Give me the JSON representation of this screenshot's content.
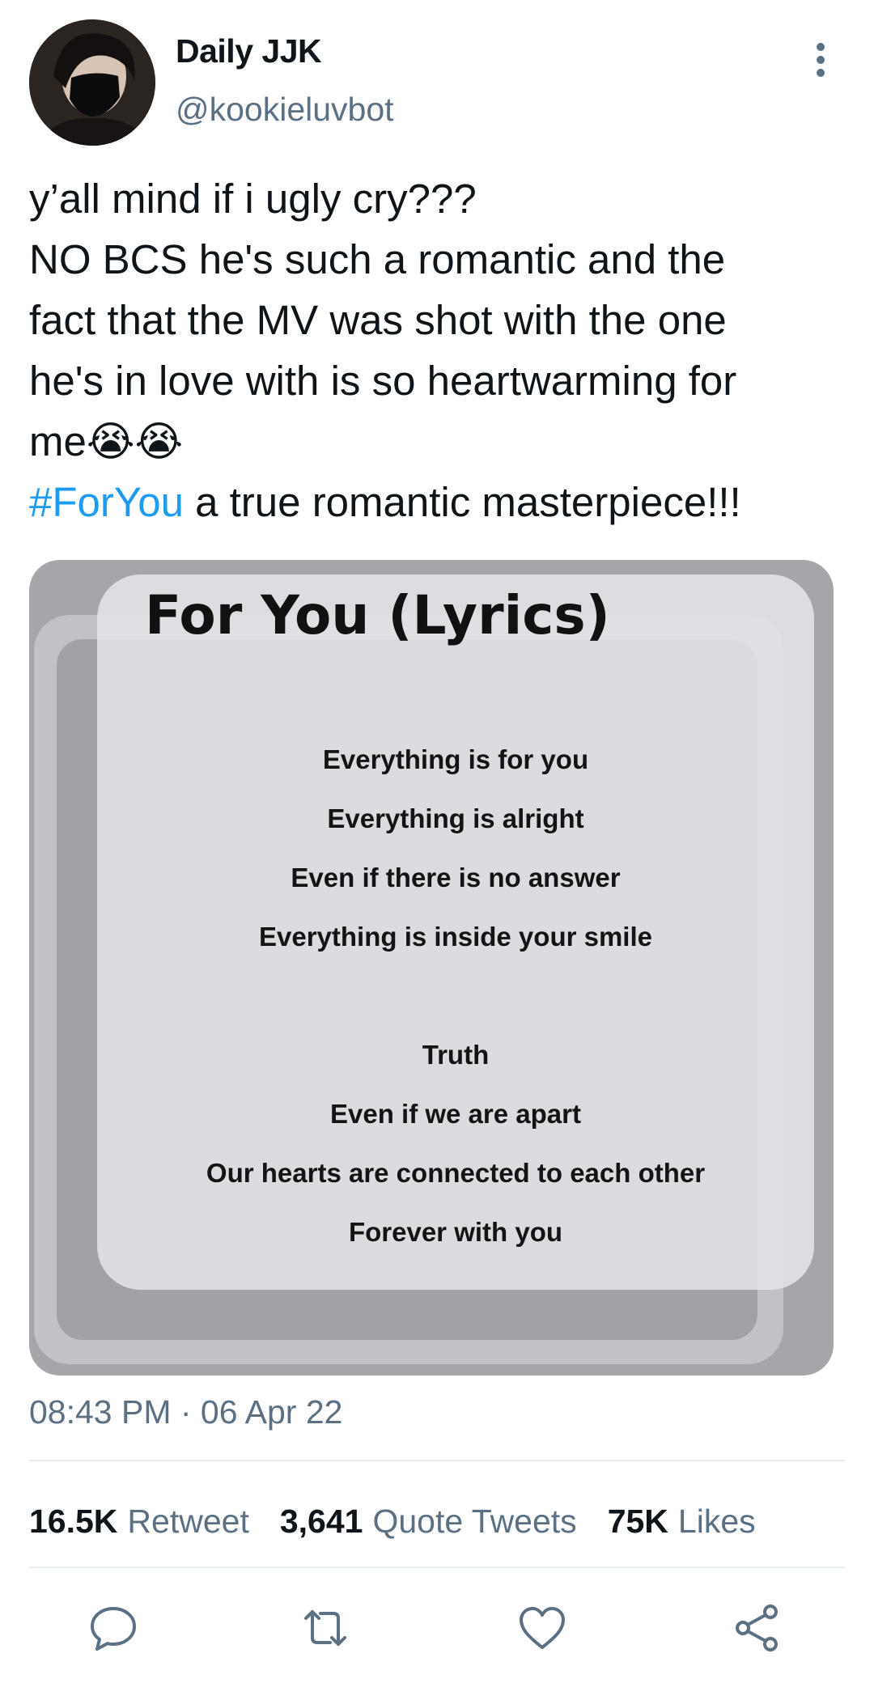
{
  "tweet": {
    "author": {
      "display_name": "Daily JJK",
      "handle": "@kookieluvbot"
    },
    "text_lines": [
      "y’all mind if i ugly cry???",
      "NO BCS he's such a romantic and the",
      "fact that the MV was shot with the one",
      "he's in love with is so heartwarming for",
      "me😭😭"
    ],
    "hashtag": "#ForYou",
    "hashtag_suffix": " a true romantic masterpiece!!!",
    "media": {
      "title": "For You (Lyrics)",
      "lyrics": [
        "Everything is for you",
        "Everything is alright",
        "Even if there is no answer",
        "Everything is inside your smile",
        "",
        "Truth",
        "Even if we are apart",
        "Our hearts are connected to each other",
        "Forever with you"
      ]
    },
    "timestamp": "08:43 PM · 06 Apr 22",
    "stats": {
      "retweets": {
        "count": "16.5K",
        "label": "Retweet"
      },
      "quotes": {
        "count": "3,641",
        "label": "Quote Tweets"
      },
      "likes": {
        "count": "75K",
        "label": "Likes"
      }
    },
    "actions": [
      "reply-icon",
      "retweet-icon",
      "like-icon",
      "share-icon"
    ],
    "colors": {
      "hashtag": "#1d9bf0",
      "secondary_text": "#5b7083",
      "primary_text": "#0f1419",
      "divider": "#e6ecf0"
    }
  }
}
